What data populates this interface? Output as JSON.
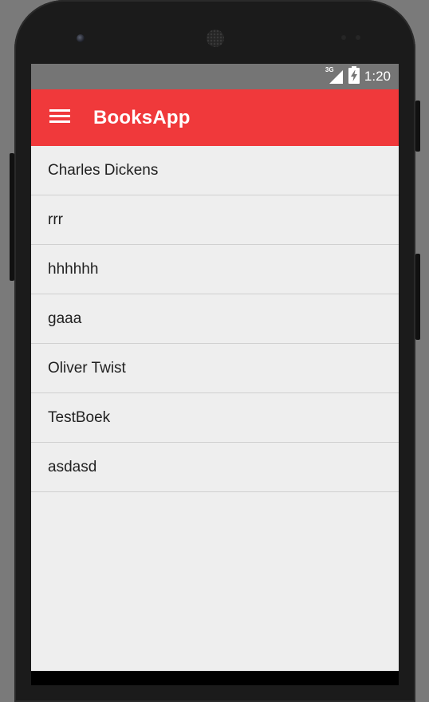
{
  "status_bar": {
    "network_type": "3G",
    "time": "1:20",
    "icons": [
      "signal-icon",
      "battery-charging-icon"
    ]
  },
  "app_bar": {
    "title": "BooksApp",
    "menu_icon": "hamburger-menu-icon",
    "color": "#f0393b"
  },
  "books": [
    {
      "title": "Charles Dickens"
    },
    {
      "title": "rrr"
    },
    {
      "title": "hhhhhh"
    },
    {
      "title": "gaaa"
    },
    {
      "title": "Oliver Twist"
    },
    {
      "title": "TestBoek"
    },
    {
      "title": "asdasd"
    }
  ]
}
